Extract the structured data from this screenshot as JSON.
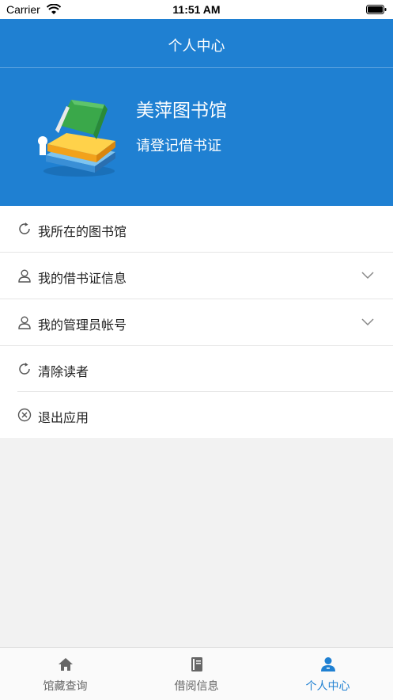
{
  "status_bar": {
    "carrier": "Carrier",
    "time": "11:51 AM"
  },
  "navbar": {
    "title": "个人中心"
  },
  "profile": {
    "library_name": "美萍图书馆",
    "login_prompt": "请登记借书证"
  },
  "menu": [
    {
      "label": "我所在的图书馆",
      "icon": "refresh-icon",
      "expandable": false
    },
    {
      "label": "我的借书证信息",
      "icon": "user-icon",
      "expandable": true
    },
    {
      "label": "我的管理员帐号",
      "icon": "user-icon",
      "expandable": true
    },
    {
      "label": "清除读者",
      "icon": "refresh-icon",
      "expandable": false
    },
    {
      "label": "退出应用",
      "icon": "close-circle-icon",
      "expandable": false
    }
  ],
  "tabs": [
    {
      "label": "馆藏查询",
      "icon": "home-icon",
      "active": false
    },
    {
      "label": "借阅信息",
      "icon": "book-icon",
      "active": false
    },
    {
      "label": "个人中心",
      "icon": "person-icon",
      "active": true
    }
  ],
  "colors": {
    "primary": "#1f80d2",
    "tab_inactive": "#666666",
    "icon_gray": "#555555"
  }
}
